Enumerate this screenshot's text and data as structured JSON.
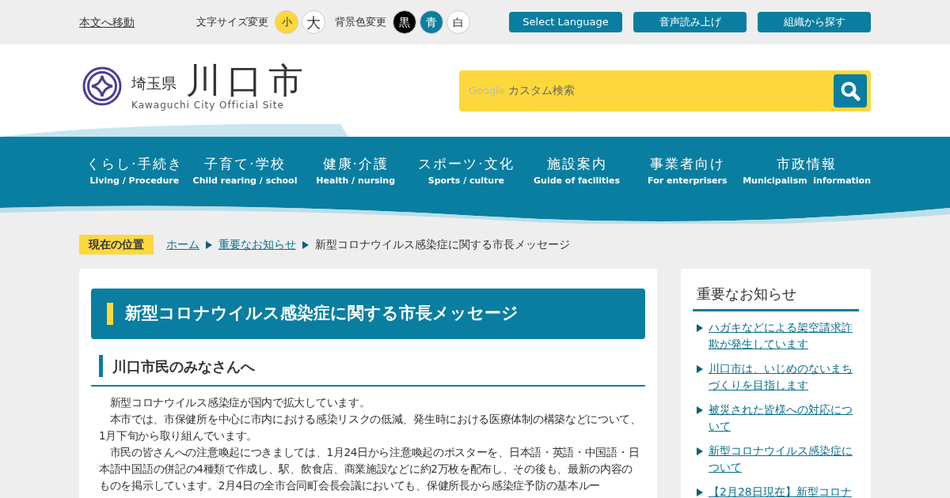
{
  "top_bar": {
    "skip_link": "本文へ移動",
    "font_size": {
      "label": "文字サイズ変更",
      "options": [
        {
          "label": "小",
          "selected": true
        },
        {
          "label": "大",
          "selected": false
        }
      ]
    },
    "background_color": {
      "label": "背景色変更",
      "options": [
        {
          "label": "黒",
          "color": "#000000"
        },
        {
          "label": "青",
          "color": "#0a7ea0"
        },
        {
          "label": "白",
          "color": "#ffffff"
        }
      ]
    },
    "buttons": [
      "Select Language",
      "音声読み上げ",
      "組織から探す"
    ]
  },
  "header": {
    "prefecture": "埼玉県",
    "city": "川口市",
    "subtitle": "Kawaguchi City Official Site",
    "search": {
      "brand": "Google",
      "placeholder": "カスタム検索"
    }
  },
  "nav": [
    {
      "ja": "くらし·手続き",
      "en": "Living / Procedure"
    },
    {
      "ja": "子育て·学校",
      "en": "Child rearing / school"
    },
    {
      "ja": "健康·介護",
      "en": "Health / nursing"
    },
    {
      "ja": "スポーツ·文化",
      "en": "Sports / culture"
    },
    {
      "ja": "施設案内",
      "en": "Guide of facilities"
    },
    {
      "ja": "事業者向け",
      "en": "For enterprisers"
    },
    {
      "ja": "市政情報",
      "en": "Municipalism  information"
    }
  ],
  "breadcrumb": {
    "label": "現在の位置",
    "items": [
      {
        "text": "ホーム",
        "link": true
      },
      {
        "text": "重要なお知らせ",
        "link": true
      },
      {
        "text": "新型コロナウイルス感染症に関する市長メッセージ",
        "link": false
      }
    ]
  },
  "article": {
    "title": "新型コロナウイルス感染症に関する市長メッセージ",
    "heading": "川口市民のみなさんへ",
    "paragraphs": [
      "新型コロナウイルス感染症が国内で拡大しています。",
      "本市では、市保健所を中心に市内における感染リスクの低減、発生時における医療体制の構築などについて、1月下旬から取り組んでいます。",
      "市民の皆さんへの注意喚起につきましては、1月24日から注意喚起のポスターを、日本語・英語・中国語・日本語中国語の併記の4種類で作成し、駅、飲食店、商業施設などに約2万枚を配布し、その後も、最新の内容のものを掲示しています。2月4日の全市合同町会長会議においても、保健所長から感染症予防の基本ルー"
    ]
  },
  "sidebar": {
    "title": "重要なお知らせ",
    "links": [
      "ハガキなどによる架空請求詐欺が発生しています",
      "川口市は、いじめのないまちづくりを目指します",
      "被災された皆様への対応について",
      "新型コロナウイルス感染症について",
      "【2月28日現在】新型コロナ"
    ]
  }
}
